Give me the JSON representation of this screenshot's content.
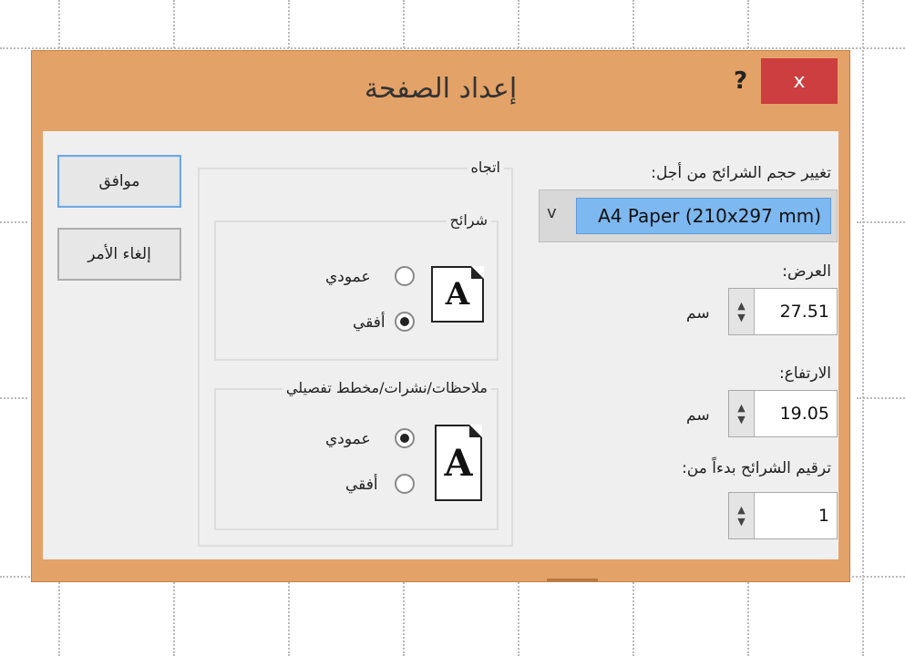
{
  "dialog": {
    "title": "إعداد الصفحة",
    "help": "?",
    "close": "x"
  },
  "size": {
    "label": "تغيير حجم الشرائح من أجل:",
    "value": "A4 Paper (210x297 mm)",
    "arrow": "v"
  },
  "width": {
    "label": "العرض:",
    "value": "27.51",
    "unit": "سم"
  },
  "height": {
    "label": "الارتفاع:",
    "value": "19.05",
    "unit": "سم"
  },
  "numbering": {
    "label": "ترقيم الشرائح بدءاً من:",
    "value": "1"
  },
  "spin": {
    "up": "▲",
    "down": "▼"
  },
  "orientation": {
    "label": "اتجاه",
    "slides": {
      "label": "شرائح",
      "portrait": "عمودي",
      "landscape": "أفقي",
      "selected": "landscape"
    },
    "notes": {
      "label": "ملاحظات/نشرات/مخطط تفصيلي",
      "portrait": "عمودي",
      "landscape": "أفقي",
      "selected": "portrait"
    },
    "icon_letter": "A"
  },
  "buttons": {
    "ok": "موافق",
    "cancel": "إلغاء الأمر"
  },
  "colors": {
    "title_bar": "#e3a267",
    "close_button": "#cc3e3f",
    "selected_item": "#7db8f0",
    "client_bg": "#efefef"
  }
}
